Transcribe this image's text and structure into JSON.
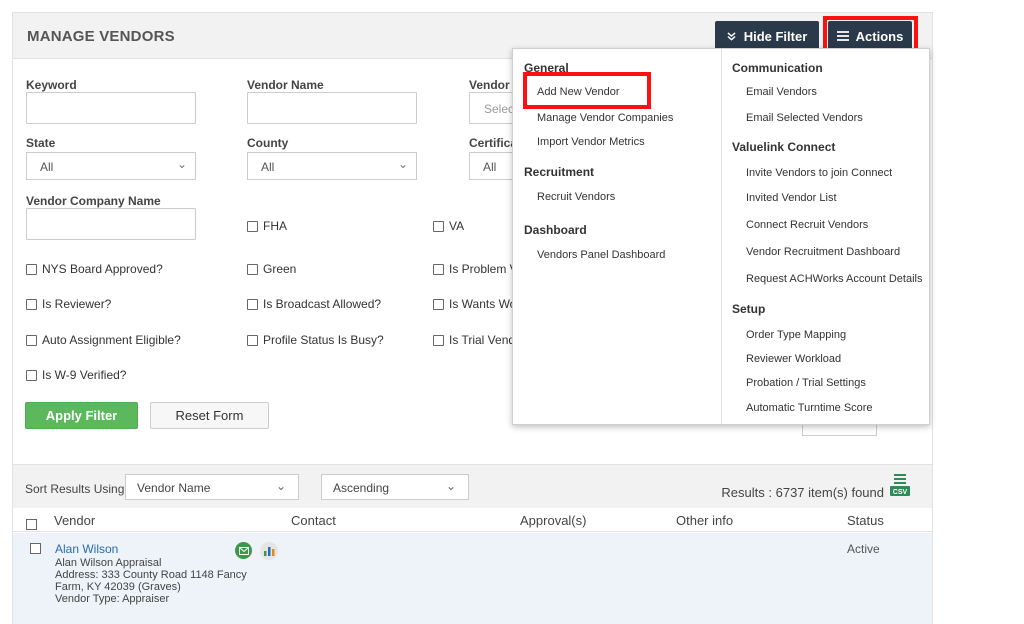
{
  "header": {
    "title": "MANAGE VENDORS",
    "hide_filter_label": "Hide Filter",
    "actions_label": "Actions"
  },
  "filters": {
    "keyword_label": "Keyword",
    "vendor_name_label": "Vendor Name",
    "vendor_type_label": "Vendor T",
    "vendor_type_placeholder": "Selec",
    "state_label": "State",
    "state_value": "All",
    "county_label": "County",
    "county_value": "All",
    "certification_label": "Certifica",
    "certification_value": "All",
    "vendor_company_name_label": "Vendor Company Name",
    "checkboxes": {
      "fha": "FHA",
      "va": "VA",
      "nys": "NYS Board Approved?",
      "green": "Green",
      "problem": "Is Problem V",
      "reviewer": "Is Reviewer?",
      "broadcast": "Is Broadcast Allowed?",
      "wants": "Is Wants Wo",
      "auto": "Auto Assignment Eligible?",
      "busy": "Profile Status Is Busy?",
      "trial": "Is Trial Vend",
      "w9": "Is W-9 Verified?"
    },
    "apply_label": "Apply Filter",
    "reset_label": "Reset Form"
  },
  "sort": {
    "label": "Sort Results Using:",
    "field_value": "Vendor Name",
    "order_value": "Ascending",
    "results_text": "Results : 6737 item(s) found"
  },
  "table": {
    "headers": {
      "vendor": "Vendor",
      "contact": "Contact",
      "approvals": "Approval(s)",
      "other": "Other info",
      "status": "Status"
    },
    "rows": [
      {
        "name": "Alan Wilson",
        "company": "Alan Wilson Appraisal",
        "address1": "Address: 333 County Road 1148 Fancy",
        "address2": "Farm, KY 42039 (Graves)",
        "type": "Vendor Type: Appraiser",
        "status": "Active"
      }
    ]
  },
  "actions_menu": {
    "general": {
      "heading": "General",
      "items": [
        "Add New Vendor",
        "Manage Vendor Companies",
        "Import Vendor Metrics"
      ]
    },
    "recruitment": {
      "heading": "Recruitment",
      "items": [
        "Recruit Vendors"
      ]
    },
    "dashboard": {
      "heading": "Dashboard",
      "items": [
        "Vendors Panel Dashboard"
      ]
    },
    "communication": {
      "heading": "Communication",
      "items": [
        "Email Vendors",
        "Email Selected Vendors"
      ]
    },
    "valuelink": {
      "heading": "Valuelink Connect",
      "items": [
        "Invite Vendors to join Connect",
        "Invited Vendor List",
        "Connect Recruit Vendors",
        "Vendor Recruitment Dashboard",
        "Request ACHWorks Account Details"
      ]
    },
    "setup": {
      "heading": "Setup",
      "items": [
        "Order Type Mapping",
        "Reviewer Workload",
        "Probation / Trial Settings",
        "Automatic Turntime Score"
      ]
    }
  },
  "colors": {
    "dark_button": "#2b3a4a",
    "apply_green": "#5cb85c",
    "highlight_red": "#ff1010",
    "link_blue": "#2a6ab0"
  }
}
